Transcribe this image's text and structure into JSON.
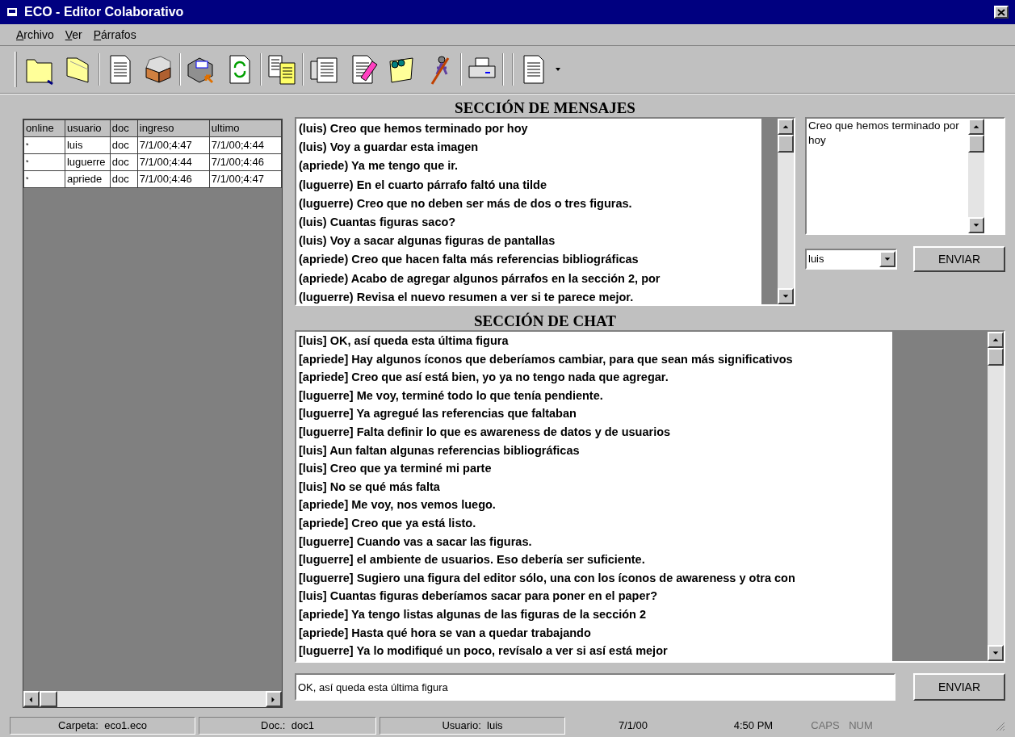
{
  "window": {
    "title": "ECO - Editor Colaborativo"
  },
  "menu": [
    {
      "label": "Archivo"
    },
    {
      "label": "Ver"
    },
    {
      "label": "Párrafos"
    }
  ],
  "users_table": {
    "columns": [
      "online",
      "usuario",
      "doc",
      "ingreso",
      "ultimo"
    ],
    "rows": [
      [
        "*",
        "luis",
        "doc",
        "7/1/00;4:47",
        "7/1/00;4:44"
      ],
      [
        "*",
        "luguerre",
        "doc",
        "7/1/00;4:44",
        "7/1/00;4:46"
      ],
      [
        "*",
        "apriede",
        "doc",
        "7/1/00;4:46",
        "7/1/00;4:47"
      ]
    ]
  },
  "messages": {
    "title": "SECCIÓN DE MENSAJES",
    "items": [
      "(luis) Creo que hemos terminado por hoy",
      "(luis) Voy a guardar esta imagen",
      "(apriede) Ya me tengo que ir.",
      "(luguerre) En el cuarto párrafo faltó una tilde",
      "(luguerre) Creo que no deben ser más de dos o tres figuras.",
      "(luis) Cuantas figuras saco?",
      "(luis) Voy a sacar algunas figuras de pantallas",
      "(apriede) Creo que hacen falta más referencias bibliográficas",
      "(apriede) Acabo de agregar algunos párrafos en la sección 2, por",
      "(luguerre) Revisa el nuevo resumen a ver si te parece mejor."
    ],
    "compose": {
      "value": "Creo que hemos terminado por hoy"
    },
    "recipient": {
      "value": "luis"
    },
    "send_button": "ENVIAR"
  },
  "chat": {
    "title": "SECCIÓN DE CHAT",
    "items": [
      "[luis] OK, así queda esta última figura",
      "[apriede] Hay algunos íconos que deberíamos cambiar, para que sean más significativos",
      "[apriede] Creo que así está bien, yo ya no tengo nada que agregar.",
      "[luguerre] Me voy, terminé todo lo que tenía pendiente.",
      "[luguerre] Ya agregué las referencias que faltaban",
      "[luguerre] Falta definir lo que es awareness de datos y de usuarios",
      "[luis] Aun faltan algunas referencias bibliográficas",
      "[luis] Creo que ya terminé mi parte",
      "[luis] No se qué más falta",
      "[apriede] Me voy, nos vemos luego.",
      "[apriede] Creo que ya está listo.",
      "[luguerre] Cuando vas a sacar las figuras.",
      "[luguerre] el ambiente de usuarios. Eso debería ser suficiente.",
      "[luguerre] Sugiero una figura del editor sólo, una con los íconos de awareness y otra con",
      "[luis] Cuantas figuras deberíamos sacar para poner en el paper?",
      "[apriede] Ya tengo listas algunas de las figuras de la sección 2",
      "[apriede] Hasta qué hora se van a quedar trabajando",
      "[luguerre] Ya lo modifiqué un poco, revísalo a ver si así está mejor"
    ],
    "input": {
      "value": "OK, así queda esta última figura"
    },
    "send_button": "ENVIAR"
  },
  "status_bar": [
    {
      "text": "Carpeta:  eco1.eco",
      "disabled": false
    },
    {
      "text": "Doc.:  doc1",
      "disabled": false
    },
    {
      "text": "Usuario:  luis",
      "disabled": false
    },
    {
      "text": "7/1/00",
      "disabled": false
    },
    {
      "text": "4:50 PM",
      "disabled": false
    },
    {
      "text": "CAPS",
      "disabled": true
    },
    {
      "text": "NUM",
      "disabled": true
    }
  ]
}
